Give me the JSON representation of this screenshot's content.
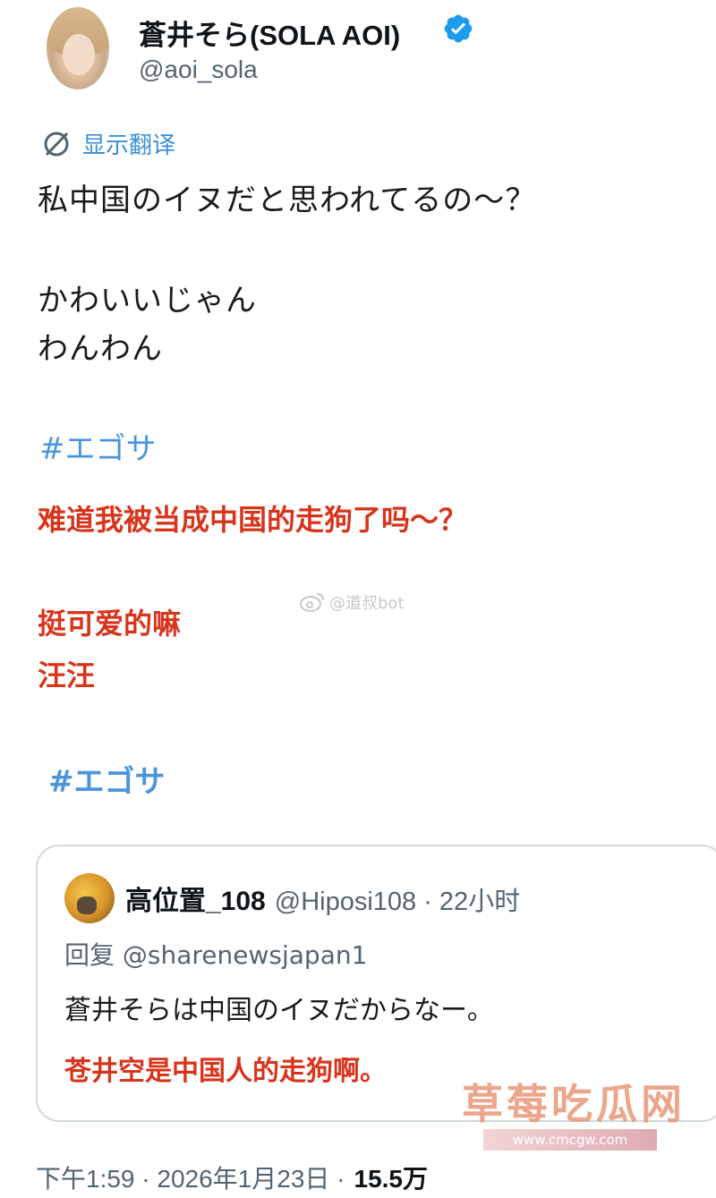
{
  "profile": {
    "display_name": "蒼井そら(SOLA AOI)",
    "handle": "@aoi_sola",
    "verified_icon": "verified-badge-icon",
    "avatar_icon": "avatar"
  },
  "translate": {
    "label": "显示翻译",
    "icon": "translate-icon"
  },
  "post": {
    "line1": "私中国のイヌだと思われてるの～？",
    "line2": "かわいいじゃん",
    "line3": "わんわん",
    "hashtag": "#エゴサ"
  },
  "translation_overlay": {
    "line1": "难道我被当成中国的走狗了吗～？",
    "line2": "挺可爱的嘛",
    "line3": "汪汪",
    "hashtag": "#エゴサ",
    "weibo_watermark": "@道叔bot"
  },
  "quote": {
    "name": "高位置_108",
    "meta": "@Hiposi108 · 22小时",
    "reply_prefix": "回复 ",
    "reply_handle": "@sharenewsjapan1",
    "text_jp": "蒼井そらは中国のイヌだからなー。",
    "text_cn": "苍井空是中国人的走狗啊。"
  },
  "site_watermark": {
    "name": "草莓吃瓜网",
    "url": "www.cmcgw.com"
  },
  "footer": {
    "timestamp": "下午1:59 · 2026年1月23日 ·",
    "views": "15.5万"
  },
  "colors": {
    "link_blue": "#3a8fd6",
    "red_text": "#d8341b",
    "verified": "#1d9bf0",
    "muted": "#536471"
  }
}
